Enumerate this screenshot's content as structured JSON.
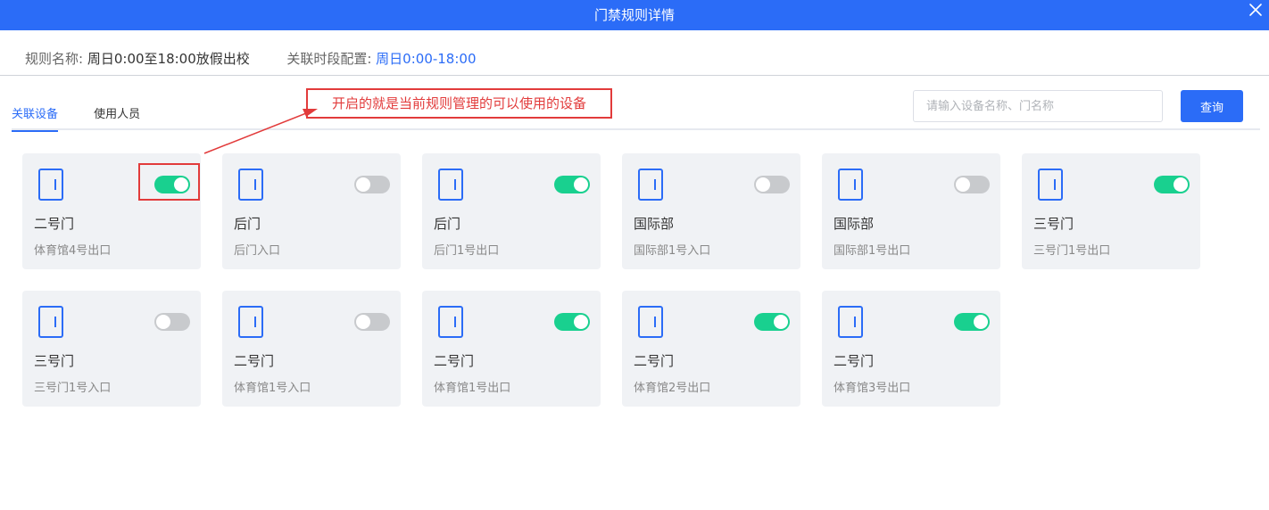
{
  "dialog": {
    "title": "门禁规则详情",
    "close_icon": "close-icon",
    "accent_color": "#2b6cf7"
  },
  "rule_info": {
    "name_label": "规则名称:",
    "name_value": "周日0:00至18:00放假出校",
    "period_label": "关联时段配置:",
    "period_value": "周日0:00-18:00"
  },
  "tabs": [
    {
      "label": "关联设备",
      "active": true
    },
    {
      "label": "使用人员",
      "active": false
    }
  ],
  "search": {
    "placeholder": "请输入设备名称、门名称",
    "button_label": "查询"
  },
  "annotation": {
    "text": "开启的就是当前规则管理的可以使用的设备",
    "color": "#e23b3b"
  },
  "device_icon": "door-icon",
  "toggle_colors": {
    "on": "#19d08f",
    "off": "#c8cacd"
  },
  "devices": [
    {
      "name": "二号门",
      "location": "体育馆4号出口",
      "enabled": true
    },
    {
      "name": "后门",
      "location": "后门入口",
      "enabled": false
    },
    {
      "name": "后门",
      "location": "后门1号出口",
      "enabled": true
    },
    {
      "name": "国际部",
      "location": "国际部1号入口",
      "enabled": false
    },
    {
      "name": "国际部",
      "location": "国际部1号出口",
      "enabled": false
    },
    {
      "name": "三号门",
      "location": "三号门1号出口",
      "enabled": true
    },
    {
      "name": "三号门",
      "location": "三号门1号入口",
      "enabled": false
    },
    {
      "name": "二号门",
      "location": "体育馆1号入口",
      "enabled": false
    },
    {
      "name": "二号门",
      "location": "体育馆1号出口",
      "enabled": true
    },
    {
      "name": "二号门",
      "location": "体育馆2号出口",
      "enabled": true
    },
    {
      "name": "二号门",
      "location": "体育馆3号出口",
      "enabled": true
    }
  ]
}
